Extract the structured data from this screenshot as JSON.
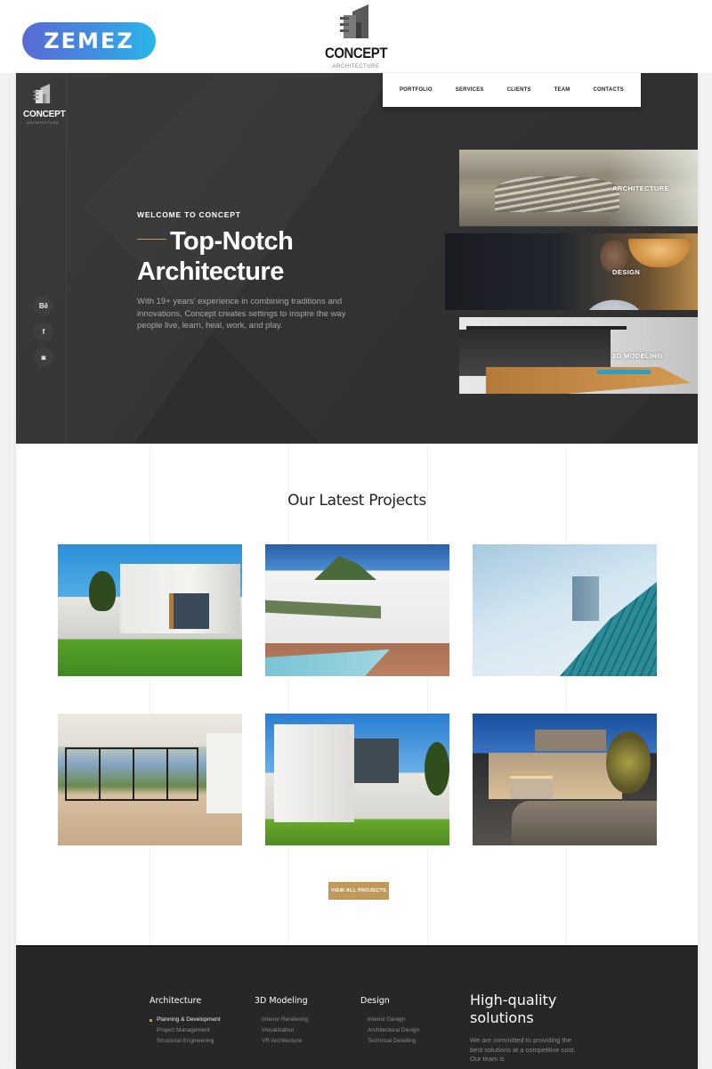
{
  "topbar": {
    "vendor_logo": "ZEMEZ",
    "brand": {
      "name": "CONCEPT",
      "tagline": "ARCHITECTURE"
    }
  },
  "hero": {
    "brand": {
      "name": "CONCEPT",
      "tagline": "ARCHITECTURE"
    },
    "nav": [
      "PORTFOLIO",
      "SERVICES",
      "CLIENTS",
      "TEAM",
      "CONTACTS"
    ],
    "social": [
      {
        "icon": "behance-icon",
        "glyph": "Bē"
      },
      {
        "icon": "facebook-icon",
        "glyph": "f"
      },
      {
        "icon": "instagram-icon",
        "glyph": "◙"
      }
    ],
    "eyebrow": "WELCOME TO CONCEPT",
    "headline_line1": "Top-Notch",
    "headline_line2": "Architecture",
    "description": "With 19+ years' experience in combining traditions and innovations, Concept creates settings to inspire the way people  live, learn, heal, work, and play.",
    "services": [
      "ARCHITECTURE",
      "DESIGN",
      "3D MODELING"
    ],
    "accent_color": "#c59a5a"
  },
  "projects": {
    "title": "Our Latest Projects",
    "items": [
      {
        "alt": "Modern concrete house with lawn"
      },
      {
        "alt": "White house with pool and wooden deck"
      },
      {
        "alt": "Curved glass facade skyscraper"
      },
      {
        "alt": "Interior with floor-to-ceiling windows"
      },
      {
        "alt": "White cube house with terrace and grass"
      },
      {
        "alt": "Illuminated modern house at dusk"
      }
    ],
    "view_all": "VIEW ALL PROJECTS",
    "button_color": "#c09a5b"
  },
  "footer": {
    "columns": [
      {
        "title": "Architecture",
        "items": [
          "Planning & Development",
          "Project Management",
          "Structural Engineering"
        ],
        "active": 0
      },
      {
        "title": "3D Modeling",
        "items": [
          "Interior Rendering",
          "Visualization",
          "VR Architecture"
        ]
      },
      {
        "title": "Design",
        "items": [
          "Interior Design",
          "Architectural Design",
          "Technical Detailing"
        ]
      }
    ],
    "promo_title": "High-quality solutions",
    "promo_text": "We are committed to providing the best solutions at a competitive cost. Our team is"
  }
}
